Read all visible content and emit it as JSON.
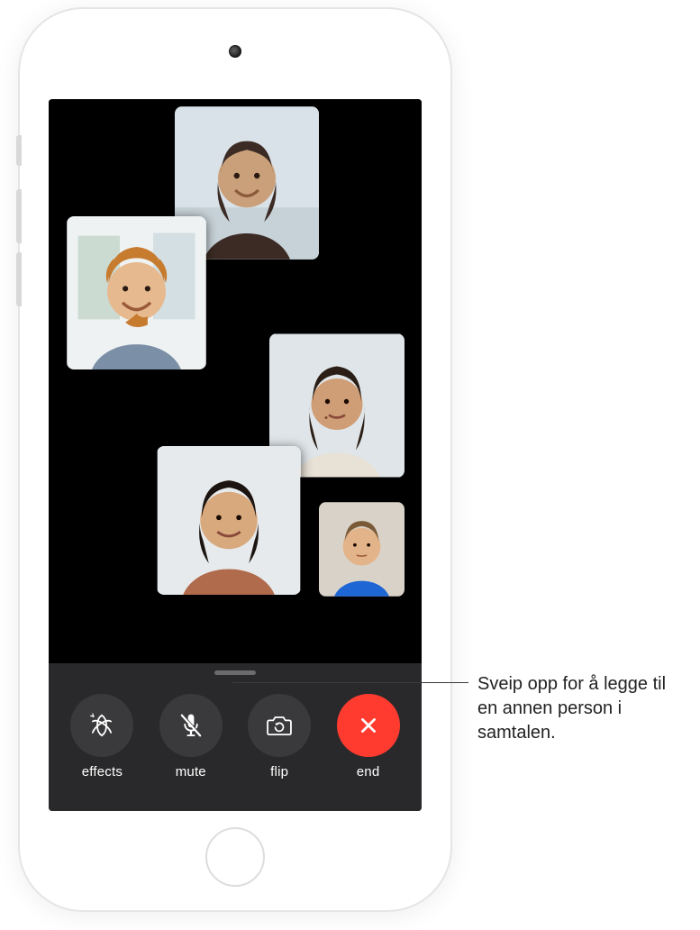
{
  "controls": {
    "effects": {
      "label": "effects",
      "icon": "effects-icon"
    },
    "mute": {
      "label": "mute",
      "icon": "mute-icon"
    },
    "flip": {
      "label": "flip",
      "icon": "flip-camera-icon"
    },
    "end": {
      "label": "end",
      "icon": "close-x-icon"
    }
  },
  "participants": [
    {
      "position": "top-center"
    },
    {
      "position": "left"
    },
    {
      "position": "right"
    },
    {
      "position": "lower-center"
    },
    {
      "position": "bottom-right-small"
    }
  ],
  "callout": {
    "text": "Sveip opp for å legge til en annen person i samtalen."
  },
  "colors": {
    "end_button": "#ff3b30",
    "panel_bg": "#2c2c2e",
    "control_bg": "#3a3a3c"
  }
}
